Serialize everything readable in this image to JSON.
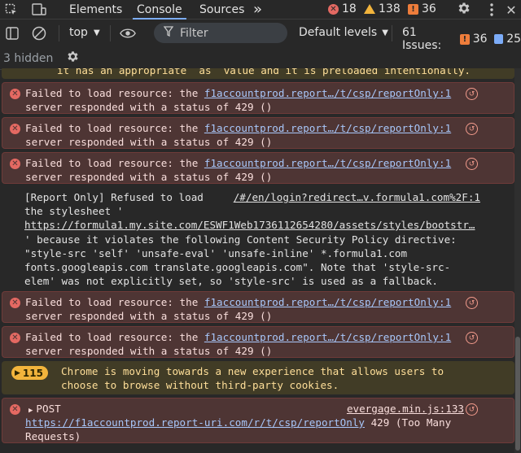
{
  "tabs": {
    "elements": "Elements",
    "console": "Console",
    "sources": "Sources",
    "more": "»"
  },
  "counters": {
    "errors": "18",
    "warnings": "138",
    "issues": "36"
  },
  "toolbar": {
    "context": "top",
    "filter_placeholder": "Filter",
    "levels": "Default levels",
    "issues_label": "61 Issues:",
    "issues_errors": "36",
    "issues_info": "25",
    "hidden": "3 hidden"
  },
  "console": {
    "truncated_top": "it has an appropriate `as` value and it is preloaded intentionally.",
    "failed1": {
      "prefix": "Failed to load resource: the ",
      "link": "f1accountprod.report…/t/csp/reportOnly:1",
      "line2": "server responded with a status of 429 ()"
    },
    "failed2": {
      "prefix": "Failed to load resource: the ",
      "link": "f1accountprod.report…/t/csp/reportOnly:1",
      "line2": "server responded with a status of 429 ()"
    },
    "failed3": {
      "prefix": "Failed to load resource: the ",
      "link": "f1accountprod.report…/t/csp/reportOnly:1",
      "line2": "server responded with a status of 429 ()"
    },
    "csp": {
      "l1": "[Report Only] Refused to load",
      "src": "/#/en/login?redirect…v.formula1.com%2F:1",
      "l2": "the stylesheet '",
      "url": "https://formula1.my.site.com/ESWF1Web1736112654280/assets/styles/bootstr…",
      "l3": "' because it violates the following Content Security Policy directive:",
      "l4": "\"style-src 'self' 'unsafe-eval' 'unsafe-inline' *.formula1.com",
      "l5": "fonts.googleapis.com translate.googleapis.com\". Note that 'style-src-",
      "l6": "elem' was not explicitly set, so 'style-src' is used as a fallback."
    },
    "failed4": {
      "prefix": "Failed to load resource: the ",
      "link": "f1accountprod.report…/t/csp/reportOnly:1",
      "line2": "server responded with a status of 429 ()"
    },
    "failed5": {
      "prefix": "Failed to load resource: the ",
      "link": "f1accountprod.report…/t/csp/reportOnly:1",
      "line2": "server responded with a status of 429 ()"
    },
    "chrome": {
      "count": "115",
      "l1": "Chrome is moving towards a new experience that allows users to",
      "l2": "choose to browse without third-party cookies."
    },
    "post": {
      "label": "POST",
      "src": "evergage.min.js:133",
      "url": "https://f1accountprod.report-uri.com/r/t/csp/reportOnly",
      "status": " 429 (Too Many",
      "l3": "Requests)"
    }
  }
}
